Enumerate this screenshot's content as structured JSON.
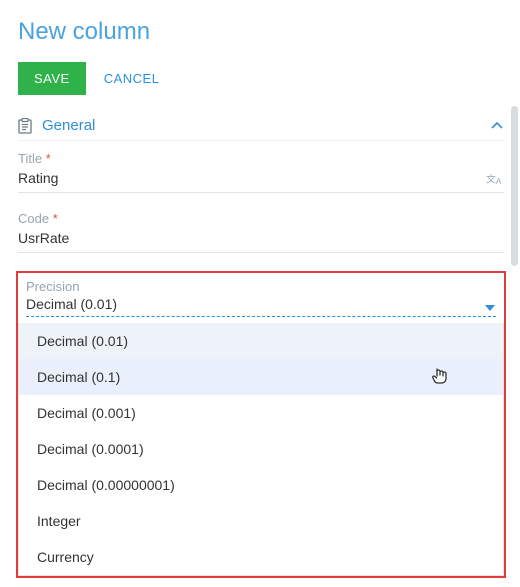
{
  "page_title": "New column",
  "actions": {
    "save": "SAVE",
    "cancel": "CANCEL"
  },
  "section": {
    "name": "General"
  },
  "fields": {
    "title": {
      "label": "Title",
      "value": "Rating",
      "required": true
    },
    "code": {
      "label": "Code",
      "value": "UsrRate",
      "required": true
    },
    "precision": {
      "label": "Precision",
      "value": "Decimal (0.01)",
      "options": [
        "Decimal (0.01)",
        "Decimal (0.1)",
        "Decimal (0.001)",
        "Decimal (0.0001)",
        "Decimal (0.00000001)",
        "Integer",
        "Currency"
      ],
      "selected_index": 0,
      "hover_index": 1
    }
  },
  "icons": {
    "form": "form-icon",
    "chevron_up": "chevron-up-icon",
    "translate": "translate-icon",
    "caret_down": "caret-down-icon",
    "pointer_cursor": "pointer-cursor-icon"
  }
}
